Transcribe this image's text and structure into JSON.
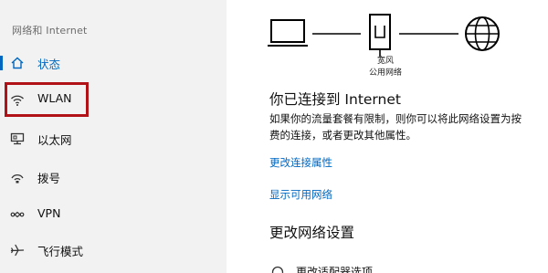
{
  "sidebar": {
    "header": "网络和 Internet",
    "items": [
      {
        "label": "状态",
        "icon": "home-icon",
        "active": true
      },
      {
        "label": "WLAN",
        "icon": "wifi-icon",
        "active": false
      },
      {
        "label": "以太网",
        "icon": "ethernet-icon",
        "active": false
      },
      {
        "label": "拨号",
        "icon": "dialup-icon",
        "active": false
      },
      {
        "label": "VPN",
        "icon": "vpn-icon",
        "active": false
      },
      {
        "label": "飞行模式",
        "icon": "airplane-icon",
        "active": false
      }
    ]
  },
  "diagram": {
    "device_icon": "laptop-icon",
    "router_icon": "router-icon",
    "internet_icon": "globe-icon",
    "caption_line1": "宽风",
    "caption_line2": "公用网络"
  },
  "status": {
    "title": "你已连接到 Internet",
    "desc_line1": "如果你的流量套餐有限制，则你可以将此网络设置为按",
    "desc_line2": "费的连接，或者更改其他属性。"
  },
  "links": {
    "change_properties": "更改连接属性",
    "show_networks": "显示可用网络"
  },
  "settings": {
    "title": "更改网络设置",
    "partial_item": "更改适配器选项"
  },
  "colors": {
    "accent": "#0067c0",
    "highlight": "#b01218",
    "sidebar_bg": "#f2f2f2"
  }
}
